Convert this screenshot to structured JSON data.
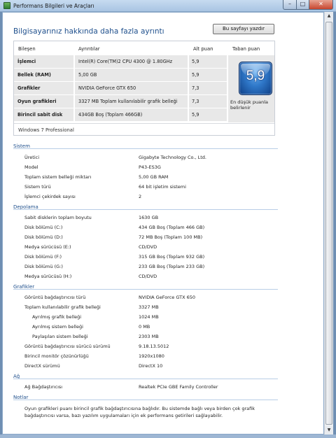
{
  "window": {
    "title": "Performans Bilgileri ve Araçları",
    "min_label": "–",
    "max_label": "□",
    "close_label": "✕"
  },
  "header": {
    "heading": "Bilgisayarınız hakkında daha fazla ayrıntı",
    "print_button": "Bu sayfayı yazdır"
  },
  "score_table": {
    "columns": {
      "component": "Bileşen",
      "details": "Ayrıntılar",
      "subscore": "Alt puan",
      "base": "Taban puan"
    },
    "rows": [
      {
        "component": "İşlemci",
        "details": "Intel(R) Core(TM)2 CPU 4300 @ 1.80GHz",
        "subscore": "5,9"
      },
      {
        "component": "Bellek (RAM)",
        "details": "5,00 GB",
        "subscore": "5,9"
      },
      {
        "component": "Grafikler",
        "details": "NVIDIA GeForce GTX 650",
        "subscore": "7,3"
      },
      {
        "component": "Oyun grafikleri",
        "details": "3327 MB Toplam kullanılabilir grafik belleği",
        "subscore": "7,3"
      },
      {
        "component": "Birincil sabit disk",
        "details": "434GB Boş (Toplam 466GB)",
        "subscore": "5,9"
      }
    ],
    "base_score": "5,9",
    "base_caption": "En düşük puanla belirlenir",
    "os": "Windows 7 Professional"
  },
  "sections": {
    "system": {
      "title": "Sistem",
      "items": [
        {
          "key": "Üretici",
          "value": "Gigabyte Technology Co., Ltd."
        },
        {
          "key": "Model",
          "value": "P43-ES3G"
        },
        {
          "key": "Toplam sistem belleği miktarı",
          "value": "5,00 GB RAM"
        },
        {
          "key": "Sistem türü",
          "value": "64 bit işletim sistemi"
        },
        {
          "key": "İşlemci çekirdek sayısı",
          "value": "2"
        }
      ]
    },
    "storage": {
      "title": "Depolama",
      "items": [
        {
          "key": "Sabit disklerin toplam boyutu",
          "value": "1630 GB"
        },
        {
          "key": "Disk bölümü (C:)",
          "value": "434 GB Boş (Toplam 466 GB)"
        },
        {
          "key": "Disk bölümü (D:)",
          "value": "72 MB Boş (Toplam 100 MB)"
        },
        {
          "key": "Medya sürücüsü (E:)",
          "value": "CD/DVD"
        },
        {
          "key": "Disk bölümü (F:)",
          "value": "315 GB Boş (Toplam 932 GB)"
        },
        {
          "key": "Disk bölümü (G:)",
          "value": "233 GB Boş (Toplam 233 GB)"
        },
        {
          "key": "Medya sürücüsü (H:)",
          "value": "CD/DVD"
        }
      ]
    },
    "graphics": {
      "title": "Grafikler",
      "items": [
        {
          "key": "Görüntü bağdaştırıcısı türü",
          "value": "NVIDIA GeForce GTX 650"
        },
        {
          "key": "Toplam kullanılabilir grafik belleği",
          "value": "3327 MB"
        },
        {
          "key": "Ayrılmış grafik belleği",
          "value": "1024 MB"
        },
        {
          "key": "Ayrılmış sistem belleği",
          "value": "0 MB"
        },
        {
          "key": "Paylaşılan sistem belleği",
          "value": "2303 MB"
        },
        {
          "key": "Görüntü bağdaştırıcısı sürücü sürümü",
          "value": "9.18.13.5012"
        },
        {
          "key": "Birincil monitör çözünürlüğü",
          "value": "1920x1080"
        },
        {
          "key": "DirectX sürümü",
          "value": "DirectX 10"
        }
      ]
    },
    "network": {
      "title": "Ağ",
      "items": [
        {
          "key": "Ağ Bağdaştırıcısı",
          "value": "Realtek PCIe GBE Family Controller"
        }
      ]
    },
    "notes": {
      "title": "Notlar",
      "text": "Oyun grafikleri puanı birincil grafik bağdaştırıcısına bağlıdır. Bu sistemde bağlı veya birden çok grafik bağdaştırıcısı varsa, bazı yazılım uygulamaları için ek performans getirileri sağlayabilir."
    }
  },
  "colors": {
    "heading": "#1e4f8c",
    "badge": "#2f78c9",
    "row_bg": "#e8e8e8"
  },
  "icons": {
    "app": "performance-app-icon",
    "scroll_up": "scroll-up-arrow-icon",
    "scroll_down": "scroll-down-arrow-icon"
  }
}
